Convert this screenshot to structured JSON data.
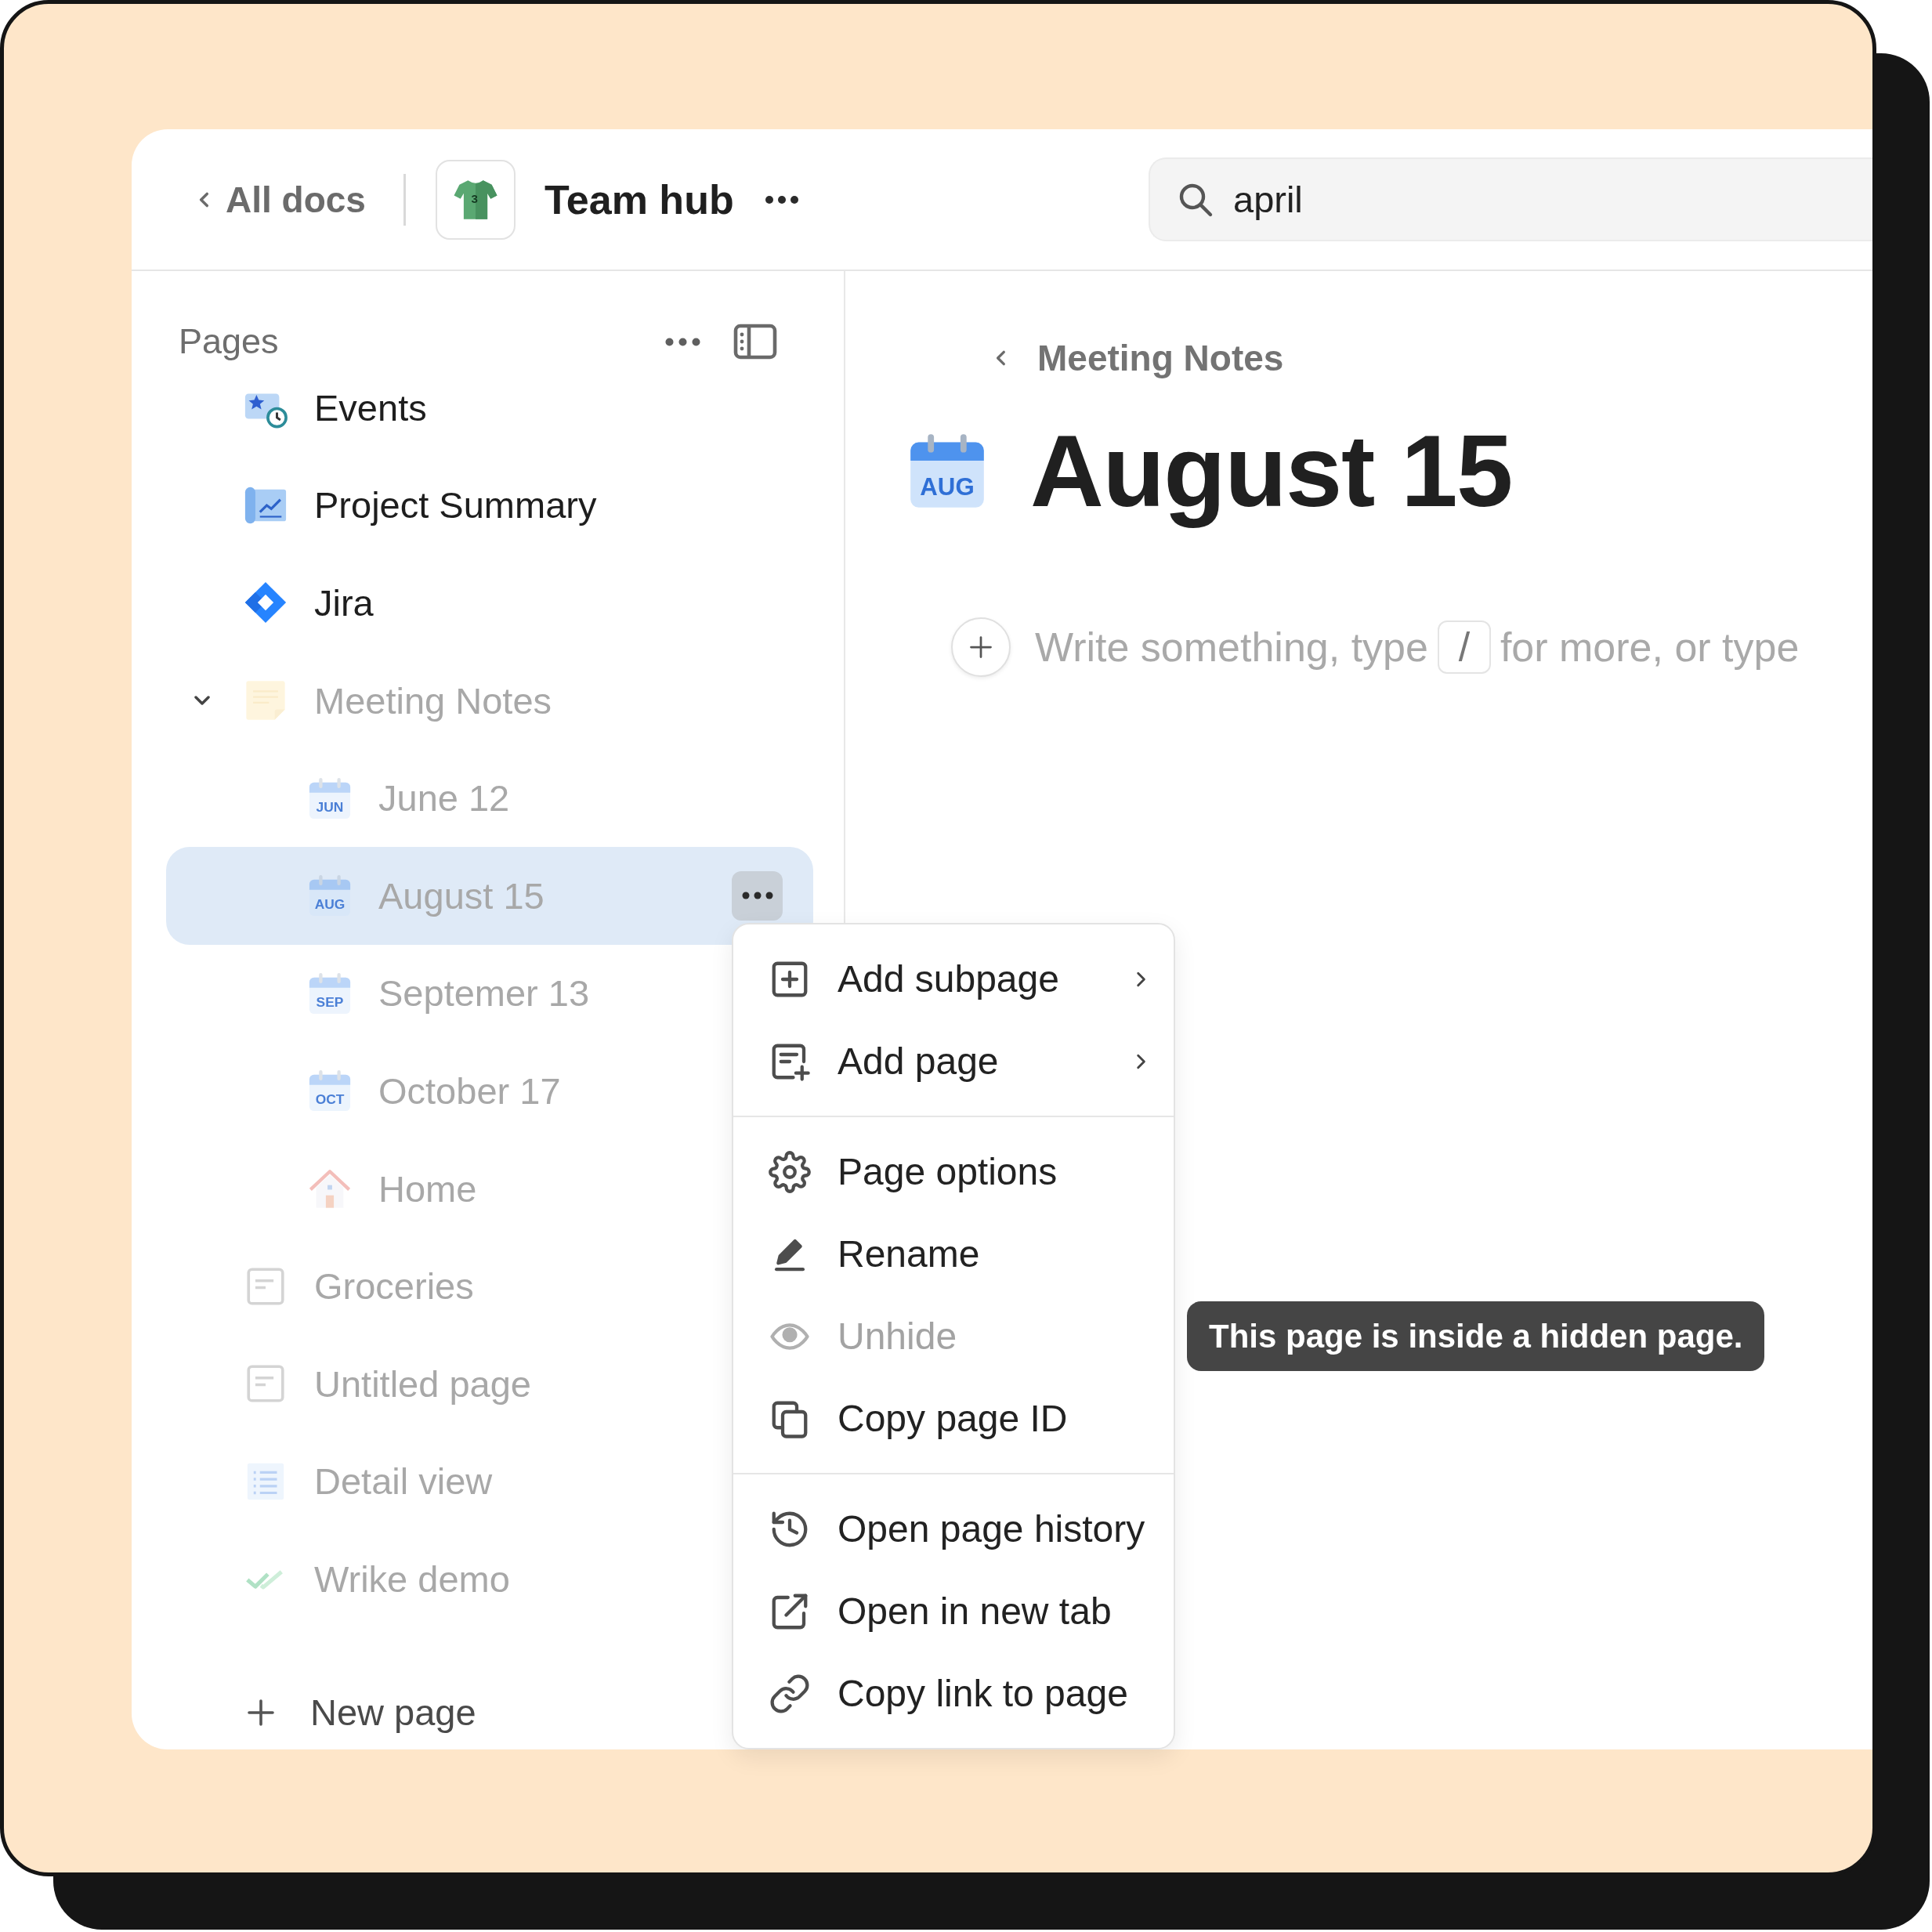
{
  "header": {
    "back_link": "All docs",
    "workspace": {
      "name": "Team hub",
      "icon_text": "3"
    },
    "search": {
      "value": "april"
    }
  },
  "sidebar": {
    "title": "Pages",
    "items": [
      {
        "label": "Events",
        "kind": "events",
        "hidden": false,
        "selected": false
      },
      {
        "label": "Project Summary",
        "kind": "chart",
        "hidden": false,
        "selected": false
      },
      {
        "label": "Jira",
        "kind": "jira",
        "hidden": false,
        "selected": false
      },
      {
        "label": "Meeting Notes",
        "kind": "note",
        "hidden": true,
        "selected": false,
        "expanded": true,
        "children": [
          {
            "label": "June 12",
            "kind": "calendar",
            "icon_text": "JUN",
            "hidden": true,
            "selected": false
          },
          {
            "label": "August 15",
            "kind": "calendar",
            "icon_text": "AUG",
            "hidden": true,
            "selected": true
          },
          {
            "label": "Septemer 13",
            "kind": "calendar",
            "icon_text": "SEP",
            "hidden": true,
            "selected": false
          },
          {
            "label": "October 17",
            "kind": "calendar",
            "icon_text": "OCT",
            "hidden": true,
            "selected": false
          },
          {
            "label": "Home",
            "kind": "house",
            "hidden": true,
            "selected": false
          }
        ]
      },
      {
        "label": "Groceries",
        "kind": "page",
        "hidden": true,
        "selected": false
      },
      {
        "label": "Untitled page",
        "kind": "page",
        "hidden": true,
        "selected": false
      },
      {
        "label": "Detail view",
        "kind": "list",
        "hidden": true,
        "selected": false
      },
      {
        "label": "Wrike demo",
        "kind": "check",
        "hidden": true,
        "selected": false
      }
    ],
    "new_page": "New page"
  },
  "page": {
    "breadcrumb": "Meeting Notes",
    "icon_text": "AUG",
    "title": "August 15",
    "editor": {
      "placeholder": [
        {
          "kind": "text",
          "text": "Write something, type"
        },
        {
          "kind": "key",
          "text": "/"
        },
        {
          "kind": "text",
          "text": "for more, or type"
        }
      ]
    }
  },
  "context_menu": {
    "groups": [
      {
        "items": [
          {
            "label": "Add subpage",
            "kind": "plus_square",
            "submenu": true,
            "disabled": false
          },
          {
            "label": "Add page",
            "kind": "page_plus",
            "submenu": true,
            "disabled": false
          }
        ]
      },
      {
        "items": [
          {
            "label": "Page options",
            "kind": "gear",
            "submenu": false,
            "disabled": false
          },
          {
            "label": "Rename",
            "kind": "pencil",
            "submenu": false,
            "disabled": false
          },
          {
            "label": "Unhide",
            "kind": "eye",
            "submenu": false,
            "disabled": true
          },
          {
            "label": "Copy page ID",
            "kind": "copy",
            "submenu": false,
            "disabled": false
          }
        ]
      },
      {
        "items": [
          {
            "label": "Open page history",
            "kind": "history",
            "submenu": false,
            "disabled": false
          },
          {
            "label": "Open in new tab",
            "kind": "external",
            "submenu": false,
            "disabled": false
          },
          {
            "label": "Copy link to page",
            "kind": "link",
            "submenu": false,
            "disabled": false
          }
        ]
      }
    ]
  },
  "tooltip": {
    "text": "This page is inside a hidden page."
  }
}
